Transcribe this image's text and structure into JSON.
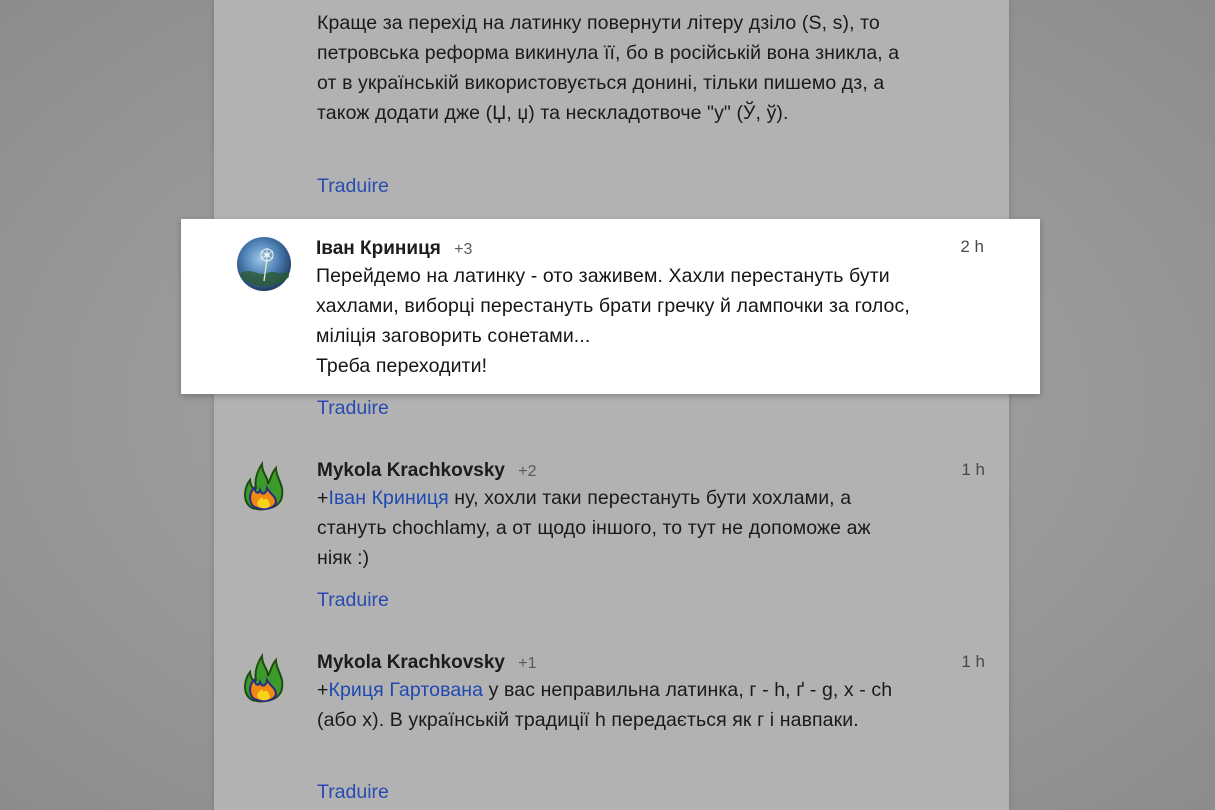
{
  "comments": [
    {
      "paragraphs": [
        "Краще за перехід на латинку повернути літеру дзіло (Ѕ, ѕ), то петровська реформа викинула її, бо в російській вона зникла, а от в українській використовується донині, тільки пишемо дз, а також додати дже (Џ, џ) та нескладотвоче \"у\" (Ў, ў)."
      ],
      "translate_label": "Traduire"
    },
    {
      "author": "Іван Криниця",
      "plus": "+3",
      "time": "2 h",
      "paragraphs": [
        "Перейдемо на латинку - ото заживем. Хахли перестануть бути хахлами, виборці перестануть брати гречку й лампочки за голос, міліція заговорить сонетами...",
        "Треба переходити!"
      ],
      "translate_label": "Traduire",
      "avatar_icon": "dandelion-globe-avatar"
    },
    {
      "author": "Mykola Krachkovsky",
      "plus": "+2",
      "time": "1 h",
      "mention_prefix": "+",
      "mention": "Іван Криниця",
      "text": " ну, хохли таки перестануть бути хохлами, а стануть chochlamy, а от щодо іншого, то тут не допоможе аж ніяк :)",
      "translate_label": "Traduire",
      "avatar_icon": "flame-avatar"
    },
    {
      "author": "Mykola Krachkovsky",
      "plus": "+1",
      "time": "1 h",
      "mention_prefix": "+",
      "mention": "Криця Гартована",
      "text": " у вас неправильна латинка, г - h, ґ - g, х - ch (або x). В українській традиції h передається як г і навпаки.",
      "translate_label": "Traduire",
      "avatar_icon": "flame-avatar"
    }
  ],
  "colors": {
    "link": "#2a4bb0",
    "overlay_panel": "#b2b2b2",
    "highlight_card": "#ffffff"
  }
}
